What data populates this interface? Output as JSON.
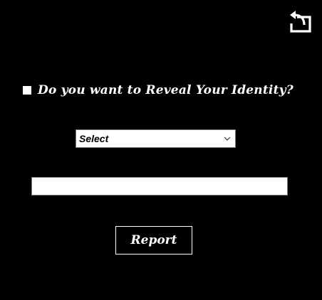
{
  "header": {
    "back_icon": "return-arrow-icon"
  },
  "reveal": {
    "checked": false,
    "label": "Do you want to Reveal Your Identity?"
  },
  "identity_select": {
    "selected": "Select"
  },
  "details_input": {
    "value": "",
    "placeholder": ""
  },
  "actions": {
    "report_label": "Report"
  },
  "colors": {
    "background": "#000000",
    "foreground": "#ffffff"
  }
}
